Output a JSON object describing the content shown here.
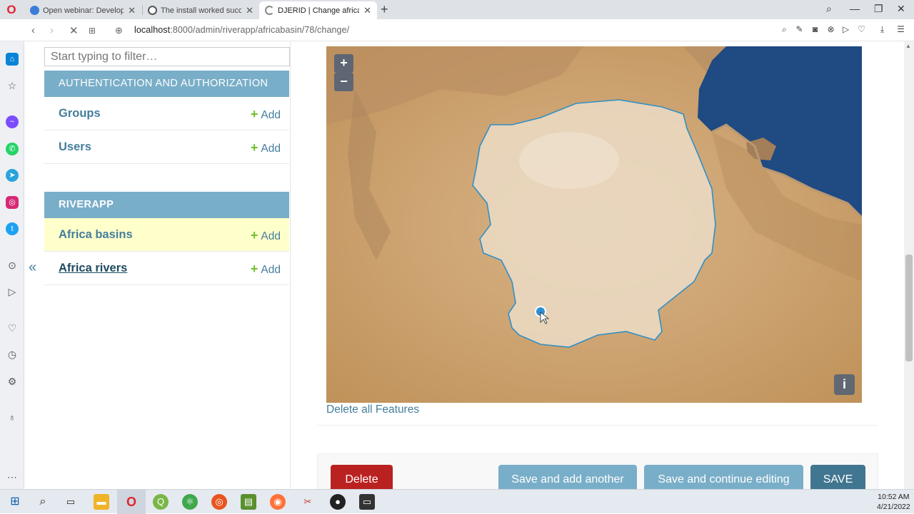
{
  "browser": {
    "tabs": [
      {
        "title": "Open webinar: Developme",
        "active": false
      },
      {
        "title": "The install worked successf",
        "active": false
      },
      {
        "title": "DJERID | Change africa basi",
        "active": true
      }
    ],
    "url_host": "localhost",
    "url_path": ":8000/admin/riverapp/africabasin/78/change/"
  },
  "nav": {
    "filter_placeholder": "Start typing to filter…",
    "sections": [
      {
        "title": "AUTHENTICATION AND AUTHORIZATION",
        "models": [
          {
            "name": "Groups",
            "add": "Add"
          },
          {
            "name": "Users",
            "add": "Add"
          }
        ]
      },
      {
        "title": "RIVERAPP",
        "models": [
          {
            "name": "Africa basins",
            "add": "Add"
          },
          {
            "name": "Africa rivers",
            "add": "Add"
          }
        ]
      }
    ],
    "collapse_glyph": "«"
  },
  "map": {
    "zoom_in": "+",
    "zoom_out": "−",
    "info": "i",
    "delete_features": "Delete all Features"
  },
  "actions": {
    "delete": "Delete",
    "save_add_another": "Save and add another",
    "save_continue": "Save and continue editing",
    "save": "SAVE"
  },
  "taskbar": {
    "time": "10:52 AM",
    "date": "4/21/2022"
  },
  "colors": {
    "header_blue": "#79aec8",
    "link_blue": "#447e9b",
    "add_green": "#70bf2b",
    "delete_red": "#ba2121",
    "save_dark": "#417690",
    "selected_row": "#ffffcc",
    "sea": "#1f4a82"
  }
}
